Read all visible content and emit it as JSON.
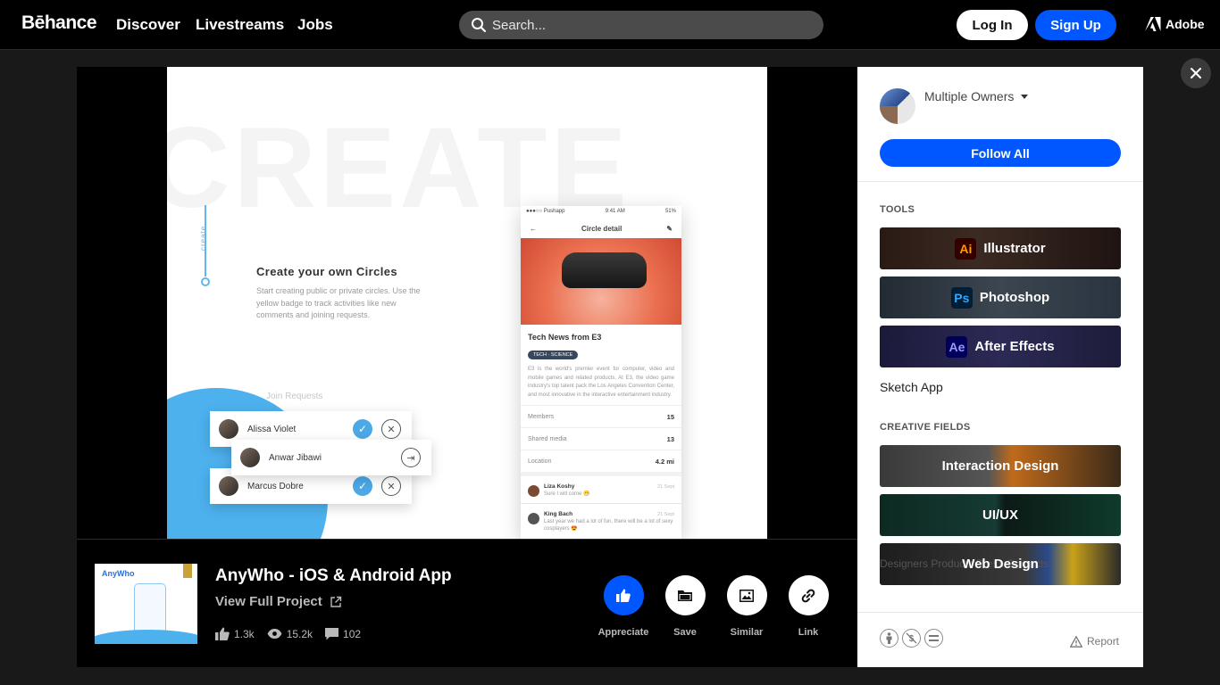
{
  "header": {
    "logo": "Bēhance",
    "nav": [
      "Discover",
      "Livestreams",
      "Jobs"
    ],
    "search_placeholder": "Search...",
    "login_label": "Log In",
    "signup_label": "Sign Up",
    "adobe_label": "Adobe"
  },
  "slide": {
    "bg_word": "CREATE",
    "side_label": "create",
    "heading": "Create your own Circles",
    "description": "Start creating public or private circles. Use the yellow badge to track activities like new comments and joining requests.",
    "join_title": "Join Requests",
    "requests": [
      {
        "name": "Alissa Violet"
      },
      {
        "name": "Anwar Jibawi"
      },
      {
        "name": "Marcus Dobre"
      }
    ],
    "phone": {
      "carrier": "●●●○○ Pushapp",
      "time": "9:41 AM",
      "battery": "51%",
      "title": "Circle detail",
      "post_title": "Tech News from E3",
      "tag": "TECH · SCIENCE",
      "body": "E3 is the world's premier event for computer, video and mobile games and related products. At E3, the video game industry's top talent pack the Los Angeles Convention Center, and most innovative in the interactive entertainment industry.",
      "rows": [
        {
          "label": "Members",
          "value": "15"
        },
        {
          "label": "Shared media",
          "value": "13"
        },
        {
          "label": "Location",
          "value": "4.2 mi"
        }
      ],
      "comments": [
        {
          "name": "Liza Koshy",
          "text": "Sure I will come 😁",
          "date": "21 Sept"
        },
        {
          "name": "King Bach",
          "text": "Last year we had a lot of fun, there will be a lot of sexy cosplayers 😍",
          "date": "21 Sept"
        }
      ]
    }
  },
  "project": {
    "thumb_label": "AnyWho",
    "title": "AnyWho - iOS & Android App",
    "view_full": "View Full Project",
    "stats": {
      "likes": "1.3k",
      "views": "15.2k",
      "comments": "102"
    },
    "actions": [
      "Appreciate",
      "Save",
      "Similar",
      "Link"
    ]
  },
  "sidebar": {
    "owner": "Multiple Owners",
    "follow_label": "Follow All",
    "tools_title": "TOOLS",
    "tools": [
      {
        "icon": "Ai",
        "name": "Illustrator"
      },
      {
        "icon": "Ps",
        "name": "Photoshop"
      },
      {
        "icon": "Ae",
        "name": "After Effects"
      }
    ],
    "sketch": "Sketch App",
    "fields_title": "CREATIVE FIELDS",
    "fields": [
      "Interaction Design",
      "UI/UX",
      "Web Design"
    ],
    "web_design_bg_text": "Designers  Products  Press  Contacts",
    "report_label": "Report"
  },
  "colors": {
    "accent": "#0057ff",
    "illustrator": "#ff9a00",
    "photoshop": "#31a8ff",
    "after_effects": "#9999ff"
  }
}
